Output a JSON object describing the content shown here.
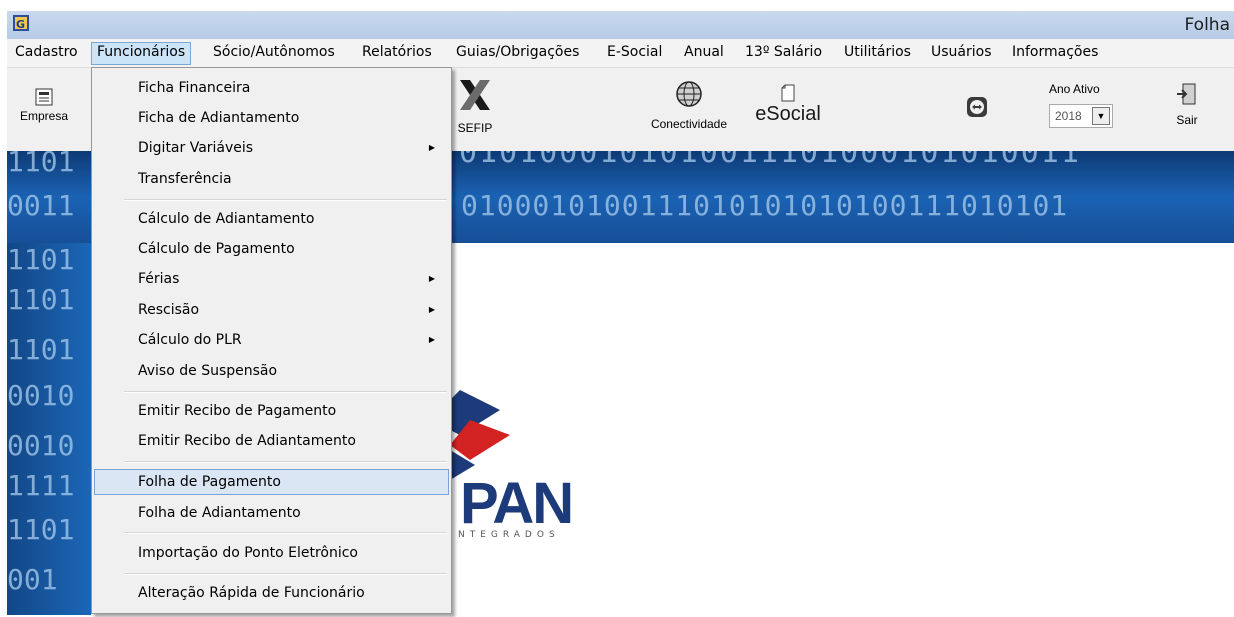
{
  "window": {
    "title": "Folha"
  },
  "menubar": {
    "items": [
      "Cadastro",
      "Funcionários",
      "Sócio/Autônomos",
      "Relatórios",
      "Guias/Obrigações",
      "E-Social",
      "Anual",
      "13º Salário",
      "Utilitários",
      "Usuários",
      "Informações"
    ]
  },
  "toolbar": {
    "empresa": "Empresa",
    "sefip": "SEFIP",
    "conectividade": "Conectividade",
    "esocial": "eSocial",
    "ano_ativo_label": "Ano Ativo",
    "ano_ativo_value": "2018",
    "sair": "Sair"
  },
  "banner": {
    "row1": "0101000101010011101000101010011",
    "row2": "0100010100111010101010100111010101"
  },
  "left_strip": {
    "rows": [
      "1101",
      "0010",
      "1101",
      "1101",
      "0010",
      "0010",
      "1111",
      "1101",
      "001"
    ],
    "top_rows": [
      "1101",
      "0011"
    ]
  },
  "logo": {
    "text": "PAN",
    "subtext": "NTEGRADOS"
  },
  "dropdown": {
    "items": [
      {
        "label": "Ficha Financeira",
        "submenu": false
      },
      {
        "label": "Ficha de Adiantamento",
        "submenu": false
      },
      {
        "label": "Digitar Variáveis",
        "submenu": true
      },
      {
        "label": "Transferência",
        "submenu": false
      },
      {
        "label": "Cálculo de Adiantamento",
        "submenu": false
      },
      {
        "label": "Cálculo de Pagamento",
        "submenu": false
      },
      {
        "label": "Férias",
        "submenu": true
      },
      {
        "label": "Rescisão",
        "submenu": true
      },
      {
        "label": "Cálculo do PLR",
        "submenu": true
      },
      {
        "label": "Aviso de Suspensão",
        "submenu": false
      },
      {
        "label": "Emitir Recibo de Pagamento",
        "submenu": false
      },
      {
        "label": "Emitir Recibo de Adiantamento",
        "submenu": false
      },
      {
        "label": "Folha de Pagamento",
        "submenu": false
      },
      {
        "label": "Folha de Adiantamento",
        "submenu": false
      },
      {
        "label": "Importação do Ponto Eletrônico",
        "submenu": false
      },
      {
        "label": "Alteração Rápida de Funcionário",
        "submenu": false
      }
    ],
    "arrow_glyph": "▶",
    "hover_label": "Folha de Pagamento"
  }
}
